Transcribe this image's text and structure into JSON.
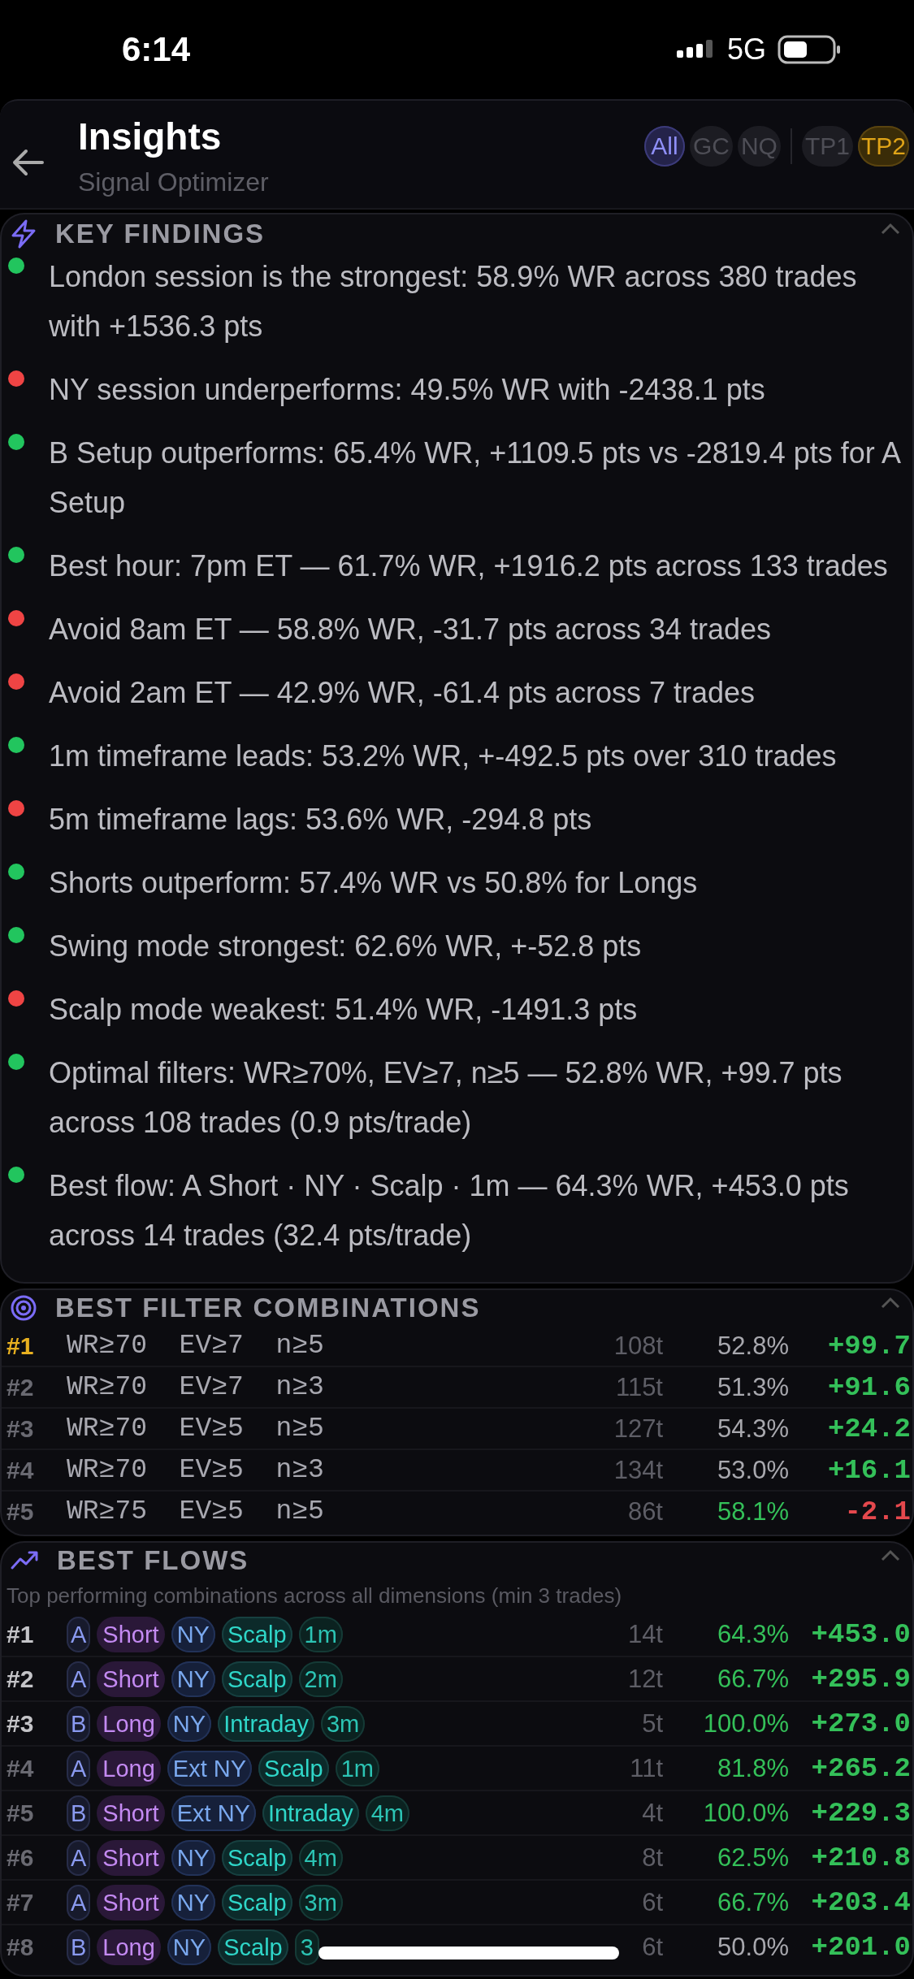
{
  "status_bar": {
    "time": "6:14",
    "network": "5G"
  },
  "header": {
    "title": "Insights",
    "subtitle": "Signal Optimizer",
    "chips": [
      {
        "label": "All",
        "kind": "market",
        "selected": true
      },
      {
        "label": "GC",
        "kind": "market",
        "selected": false
      },
      {
        "label": "NQ",
        "kind": "market",
        "selected": false
      },
      {
        "label": "TP1",
        "kind": "target",
        "selected": false
      },
      {
        "label": "TP2",
        "kind": "target",
        "selected": true
      }
    ]
  },
  "key_findings": {
    "title": "KEY FINDINGS",
    "expanded": true,
    "items": [
      {
        "text": "London session is the strongest: 58.9% WR across 380 trades with +1536.3 pts",
        "color": "#22c55e"
      },
      {
        "text": "NY session underperforms: 49.5% WR with -2438.1 pts",
        "color": "#ef4444"
      },
      {
        "text": "B Setup outperforms: 65.4% WR, +1109.5 pts vs -2819.4 pts for A Setup",
        "color": "#22c55e"
      },
      {
        "text": "Best hour: 7pm ET — 61.7% WR, +1916.2 pts across 133 trades",
        "color": "#22c55e"
      },
      {
        "text": "Avoid 8am ET — 58.8% WR, -31.7 pts across 34 trades",
        "color": "#ef4444"
      },
      {
        "text": "Avoid 2am ET — 42.9% WR, -61.4 pts across 7 trades",
        "color": "#ef4444"
      },
      {
        "text": "1m timeframe leads: 53.2% WR, +-492.5 pts over 310 trades",
        "color": "#22c55e"
      },
      {
        "text": "5m timeframe lags: 53.6% WR, -294.8 pts",
        "color": "#ef4444"
      },
      {
        "text": "Shorts outperform: 57.4% WR vs 50.8% for Longs",
        "color": "#22c55e"
      },
      {
        "text": "Swing mode strongest: 62.6% WR, +-52.8 pts",
        "color": "#22c55e"
      },
      {
        "text": "Scalp mode weakest: 51.4% WR, -1491.3 pts",
        "color": "#ef4444"
      },
      {
        "text": "Optimal filters: WR≥70%, EV≥7, n≥5 — 52.8% WR, +99.7 pts across 108 trades (0.9 pts/trade)",
        "color": "#22c55e"
      },
      {
        "text": "Best flow: A Short · NY · Scalp · 1m — 64.3% WR, +453.0 pts across 14 trades (32.4 pts/trade)",
        "color": "#22c55e"
      }
    ]
  },
  "filter_combinations": {
    "title": "BEST FILTER COMBINATIONS",
    "expanded": true,
    "rows": [
      {
        "rank": "#1",
        "kind": "top",
        "filters": "WR≥70  EV≥7  n≥5",
        "trades": "108t",
        "win_rate": "52.8%",
        "win_rate_highlight": false,
        "points": "+99.7",
        "negative": false
      },
      {
        "rank": "#2",
        "kind": "low",
        "filters": "WR≥70  EV≥7  n≥3",
        "trades": "115t",
        "win_rate": "51.3%",
        "win_rate_highlight": false,
        "points": "+91.6",
        "negative": false
      },
      {
        "rank": "#3",
        "kind": "low",
        "filters": "WR≥70  EV≥5  n≥5",
        "trades": "127t",
        "win_rate": "54.3%",
        "win_rate_highlight": false,
        "points": "+24.2",
        "negative": false
      },
      {
        "rank": "#4",
        "kind": "low",
        "filters": "WR≥70  EV≥5  n≥3",
        "trades": "134t",
        "win_rate": "53.0%",
        "win_rate_highlight": false,
        "points": "+16.1",
        "negative": false
      },
      {
        "rank": "#5",
        "kind": "low",
        "filters": "WR≥75  EV≥5  n≥5",
        "trades": "86t",
        "win_rate": "58.1%",
        "win_rate_highlight": true,
        "points": "-2.1",
        "negative": true
      }
    ]
  },
  "best_flows": {
    "title": "BEST FLOWS",
    "subtitle": "Top performing combinations across all dimensions (min 3 trades)",
    "expanded": true,
    "rows": [
      {
        "rank": "#1",
        "kind": "high",
        "tags": [
          {
            "label": "A",
            "kind": "setup"
          },
          {
            "label": "Short",
            "kind": "direction"
          },
          {
            "label": "NY",
            "kind": "session"
          },
          {
            "label": "Scalp",
            "kind": "mode"
          },
          {
            "label": "1m",
            "kind": "timeframe"
          }
        ],
        "trades": "14t",
        "win_rate": "64.3%",
        "win_rate_highlight": true,
        "points": "+453.0",
        "negative": false
      },
      {
        "rank": "#2",
        "kind": "high",
        "tags": [
          {
            "label": "A",
            "kind": "setup"
          },
          {
            "label": "Short",
            "kind": "direction"
          },
          {
            "label": "NY",
            "kind": "session"
          },
          {
            "label": "Scalp",
            "kind": "mode"
          },
          {
            "label": "2m",
            "kind": "timeframe"
          }
        ],
        "trades": "12t",
        "win_rate": "66.7%",
        "win_rate_highlight": true,
        "points": "+295.9",
        "negative": false
      },
      {
        "rank": "#3",
        "kind": "high",
        "tags": [
          {
            "label": "B",
            "kind": "setup"
          },
          {
            "label": "Long",
            "kind": "direction"
          },
          {
            "label": "NY",
            "kind": "session"
          },
          {
            "label": "Intraday",
            "kind": "mode"
          },
          {
            "label": "3m",
            "kind": "timeframe"
          }
        ],
        "trades": "5t",
        "win_rate": "100.0%",
        "win_rate_highlight": true,
        "points": "+273.0",
        "negative": false
      },
      {
        "rank": "#4",
        "kind": "low",
        "tags": [
          {
            "label": "A",
            "kind": "setup"
          },
          {
            "label": "Long",
            "kind": "direction"
          },
          {
            "label": "Ext NY",
            "kind": "session"
          },
          {
            "label": "Scalp",
            "kind": "mode"
          },
          {
            "label": "1m",
            "kind": "timeframe"
          }
        ],
        "trades": "11t",
        "win_rate": "81.8%",
        "win_rate_highlight": true,
        "points": "+265.2",
        "negative": false
      },
      {
        "rank": "#5",
        "kind": "low",
        "tags": [
          {
            "label": "B",
            "kind": "setup"
          },
          {
            "label": "Short",
            "kind": "direction"
          },
          {
            "label": "Ext NY",
            "kind": "session"
          },
          {
            "label": "Intraday",
            "kind": "mode"
          },
          {
            "label": "4m",
            "kind": "timeframe"
          }
        ],
        "trades": "4t",
        "win_rate": "100.0%",
        "win_rate_highlight": true,
        "points": "+229.3",
        "negative": false
      },
      {
        "rank": "#6",
        "kind": "low",
        "tags": [
          {
            "label": "A",
            "kind": "setup"
          },
          {
            "label": "Short",
            "kind": "direction"
          },
          {
            "label": "NY",
            "kind": "session"
          },
          {
            "label": "Scalp",
            "kind": "mode"
          },
          {
            "label": "4m",
            "kind": "timeframe"
          }
        ],
        "trades": "8t",
        "win_rate": "62.5%",
        "win_rate_highlight": true,
        "points": "+210.8",
        "negative": false
      },
      {
        "rank": "#7",
        "kind": "low",
        "tags": [
          {
            "label": "A",
            "kind": "setup"
          },
          {
            "label": "Short",
            "kind": "direction"
          },
          {
            "label": "NY",
            "kind": "session"
          },
          {
            "label": "Scalp",
            "kind": "mode"
          },
          {
            "label": "3m",
            "kind": "timeframe"
          }
        ],
        "trades": "6t",
        "win_rate": "66.7%",
        "win_rate_highlight": true,
        "points": "+203.4",
        "negative": false
      },
      {
        "rank": "#8",
        "kind": "low",
        "tags": [
          {
            "label": "B",
            "kind": "setup"
          },
          {
            "label": "Long",
            "kind": "direction"
          },
          {
            "label": "NY",
            "kind": "session"
          },
          {
            "label": "Scalp",
            "kind": "mode"
          },
          {
            "label": "3",
            "kind": "timeframe"
          }
        ],
        "trades": "6t",
        "win_rate": "50.0%",
        "win_rate_highlight": false,
        "points": "+201.0",
        "negative": false
      }
    ]
  }
}
